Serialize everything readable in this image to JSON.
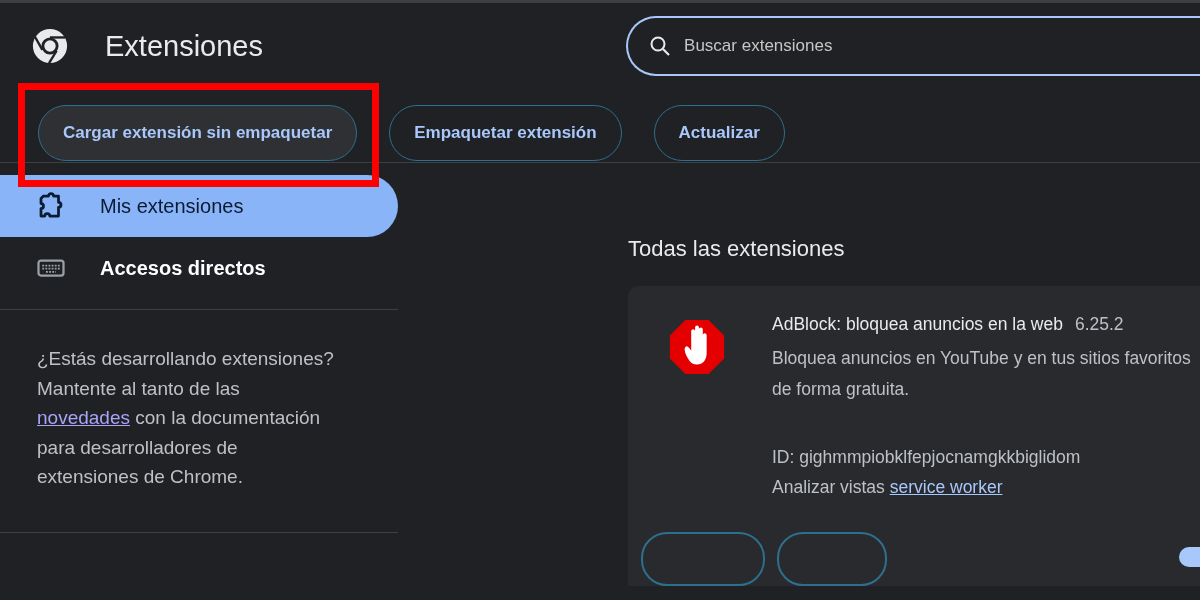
{
  "header": {
    "title": "Extensiones",
    "search": {
      "placeholder": "Buscar extensiones"
    }
  },
  "toolbar": {
    "buttons": [
      {
        "label": "Cargar extensión sin empaquetar",
        "highlighted": true
      },
      {
        "label": "Empaquetar extensión",
        "highlighted": false
      },
      {
        "label": "Actualizar",
        "highlighted": false
      }
    ]
  },
  "sidebar": {
    "items": [
      {
        "label": "Mis extensiones",
        "kind": "puzzle",
        "selected": true
      },
      {
        "label": "Accesos directos",
        "kind": "keyboard",
        "selected": false
      }
    ],
    "promo": {
      "before": "¿Estás desarrollando extensiones? Mantente al tanto de las ",
      "link": "novedades",
      "after": " con la documentación para desarrolladores de extensiones de Chrome."
    }
  },
  "main": {
    "section_title": "Todas las extensiones",
    "extensions": [
      {
        "name": "AdBlock: bloquea anuncios en la web",
        "version": "6.25.2",
        "description": "Bloquea anuncios en YouTube y en tus sitios favoritos de forma gratuita.",
        "id": "ID: gighmmpiobklfepjocnamgkkbiglidom",
        "inspect_label": "Analizar vistas",
        "inspect_link": "service worker",
        "enabled": true
      }
    ]
  }
}
